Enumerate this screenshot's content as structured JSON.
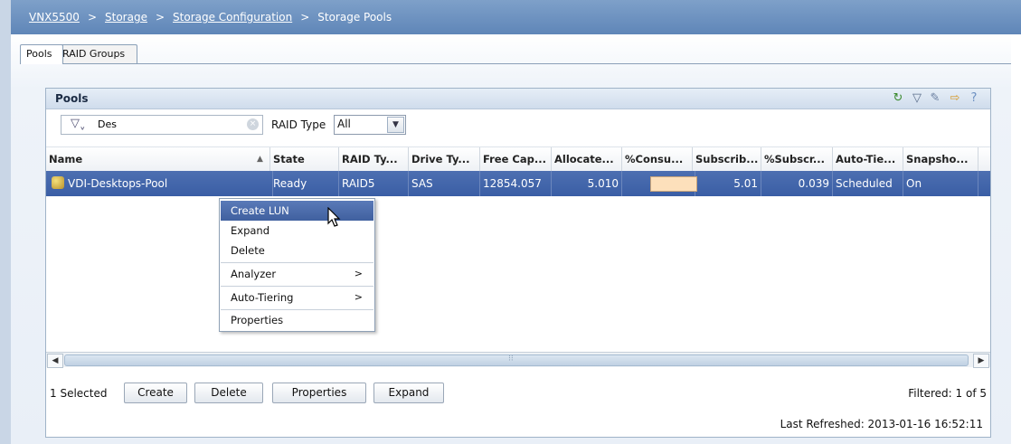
{
  "breadcrumb": {
    "items": [
      "VNX5500",
      "Storage",
      "Storage Configuration",
      "Storage Pools"
    ],
    "separator": ">"
  },
  "tabs": [
    {
      "label": "Pools",
      "active": true
    },
    {
      "label": "RAID Groups",
      "active": false
    }
  ],
  "panel": {
    "title": "Pools",
    "toolbar_icons": [
      "refresh-icon",
      "filter-icon",
      "tools-icon",
      "export-icon",
      "help-icon"
    ]
  },
  "filter": {
    "value": "Des",
    "raid_type_label": "RAID Type",
    "raid_type_value": "All"
  },
  "table": {
    "columns": [
      "Name",
      "State",
      "RAID Ty...",
      "Drive Ty...",
      "Free Cap...",
      "Allocate...",
      "%Consu...",
      "Subscrib...",
      "%Subscr...",
      "Auto-Tie...",
      "Snapsho..."
    ],
    "rows": [
      {
        "name": "VDI-Desktops-Pool",
        "state": "Ready",
        "raid_type": "RAID5",
        "drive_type": "SAS",
        "free_capacity": "12854.057",
        "allocated": "5.010",
        "percent_consumed": "",
        "subscribed": "5.01",
        "percent_subscribed": "0.039",
        "auto_tiering": "Scheduled",
        "snapshots": "On"
      }
    ]
  },
  "context_menu": {
    "items": [
      {
        "label": "Create LUN",
        "highlighted": true
      },
      {
        "label": "Expand"
      },
      {
        "label": "Delete"
      },
      {
        "label": "Analyzer",
        "submenu": true
      },
      {
        "label": "Auto-Tiering",
        "submenu": true
      },
      {
        "label": "Properties"
      }
    ],
    "submenu_arrow": ">"
  },
  "footer": {
    "selected": "1 Selected",
    "buttons": [
      "Create",
      "Delete",
      "Properties",
      "Expand"
    ],
    "filtered": "Filtered: 1 of 5",
    "last_refreshed": "Last Refreshed: 2013-01-16 16:52:11"
  },
  "colors": {
    "header_bar": "#5f86b8",
    "selected_row": "#3a5ea5",
    "consumed_bar": "#fde0bb"
  }
}
